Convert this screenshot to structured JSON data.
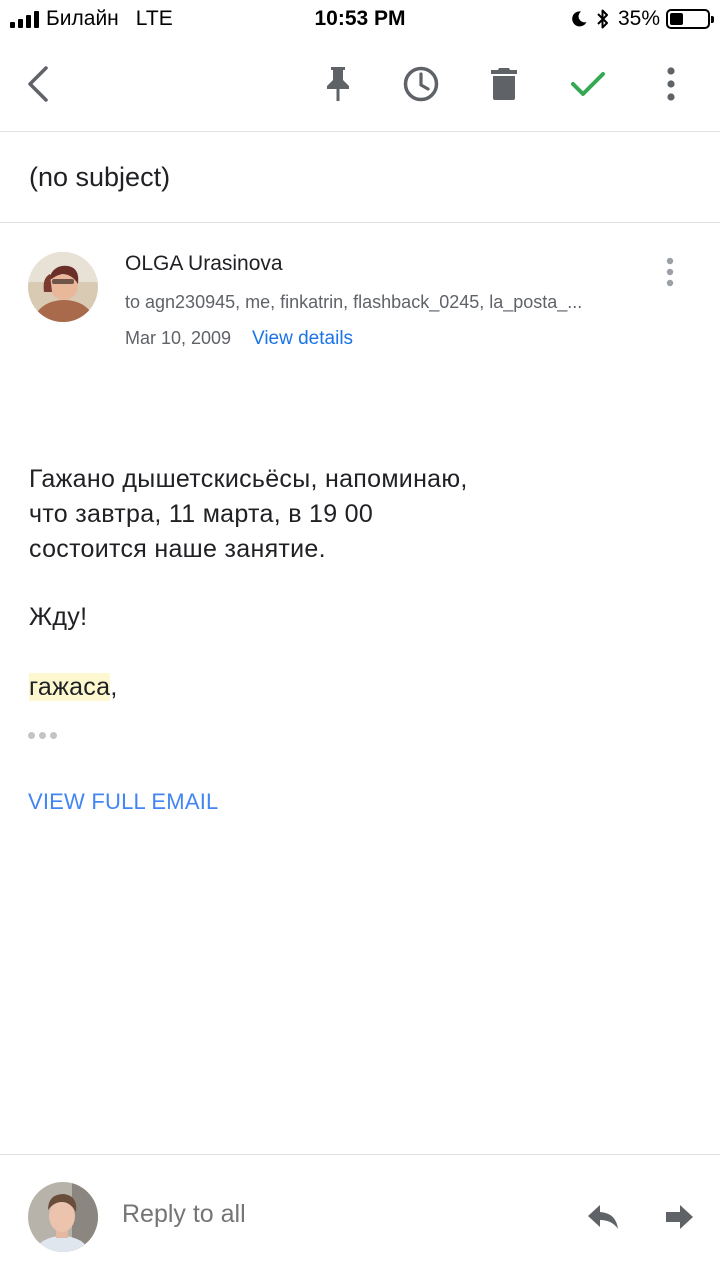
{
  "status_bar": {
    "carrier": "Билайн",
    "network": "LTE",
    "time": "10:53 PM",
    "battery_percent_label": "35%",
    "battery_level": 0.35
  },
  "toolbar": {
    "icons": [
      "back-arrow-icon",
      "pin-icon",
      "snooze-clock-icon",
      "trash-icon",
      "done-check-icon",
      "more-vert-icon"
    ],
    "accent_check_color": "#34a853",
    "icon_color": "#5f6368"
  },
  "email": {
    "subject": "(no subject)",
    "sender_name": "OLGA Urasinova",
    "recipients": "to agn230945, me, finkatrin, flashback_0245, la_posta_...",
    "date": "Mar 10, 2009",
    "view_details_label": "View details",
    "body_lines": [
      "Гажано дышетскисьёсы, напоминаю,",
      "что завтра, 11 марта, в 19 00",
      "состоится наше занятие."
    ],
    "closing": "Жду!",
    "signature": "гажаса",
    "signature_punct": ",",
    "view_full_label": "VIEW FULL EMAIL",
    "link_color": "#1a73e8"
  },
  "bottom_bar": {
    "reply_label": "Reply to all",
    "icons": [
      "reply-icon",
      "forward-icon"
    ]
  }
}
